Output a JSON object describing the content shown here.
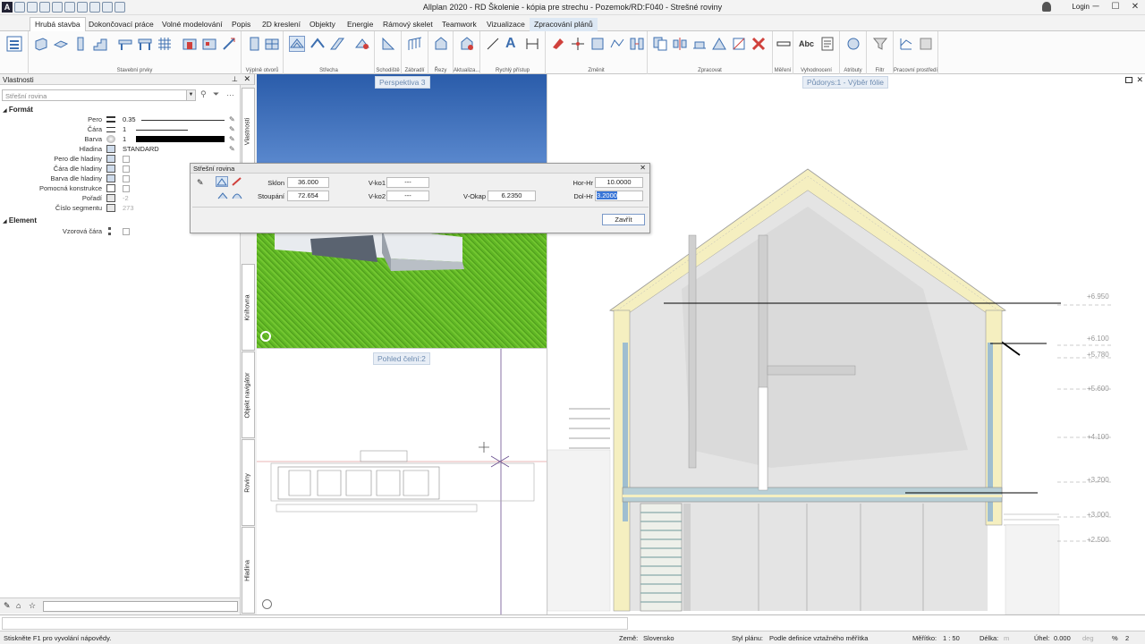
{
  "window": {
    "title": "Allplan 2020 - RD Školenie - kópia pre strechu - Pozemok/RD:F040 - Strešné roviny",
    "login": "Login",
    "app_icon_letter": "A"
  },
  "ribbon": {
    "tabs": [
      "Hrubá stavba",
      "Dokončovací práce",
      "Volné modelování",
      "Popis",
      "2D kreslení",
      "Objekty",
      "Energie",
      "Rámový skelet",
      "Teamwork",
      "Vizualizace",
      "Zpracování plánů"
    ],
    "active_tab": "Hrubá stavba",
    "groups": [
      "Stavební prvky",
      "Výplně otvorů",
      "Střecha",
      "Schodiště",
      "Zábradlí",
      "Řezy",
      "Aktualiza...",
      "Rychlý přístup",
      "Změnit",
      "Zpracovat",
      "Měření",
      "Vyhodnocení",
      "Atributy",
      "Filtr",
      "Pracovní prostředí"
    ]
  },
  "properties": {
    "title": "Vlastnosti",
    "selector_placeholder": "Střešní rovina",
    "section_format": "Formát",
    "section_element": "Element",
    "rows": {
      "pen_label": "Pero",
      "pen_value": "0.35",
      "line_label": "Čára",
      "line_value": "1",
      "color_label": "Barva",
      "color_value": "1",
      "layer_label": "Hladina",
      "layer_value": "STANDARD",
      "pen_by_layer": "Pero dle hladiny",
      "line_by_layer": "Čára dle hladiny",
      "color_by_layer": "Barva dle hladiny",
      "construction_line": "Pomocná konstrukce",
      "order_label": "Pořadí",
      "order_value": "-2",
      "segment_label": "Číslo segmentu",
      "segment_value": "273",
      "pattern_line": "Vzorová čára"
    },
    "side_tabs": [
      "Vlastnosti",
      "Knihovna",
      "Objekt navigátor",
      "Roviny",
      "Hladina"
    ]
  },
  "viewports": {
    "perspective": "Perspektiva 3",
    "front": "Pohled čelní:2",
    "plan": "Půdorys:1 - Výběr fólie"
  },
  "dialog": {
    "title": "Střešní rovina",
    "sklon_label": "Sklon",
    "sklon_value": "36.000",
    "stoupani_label": "Stoupání",
    "stoupani_value": "72.654",
    "vko1_label": "V-ko1",
    "vko1_value": "---",
    "vko2_label": "V-ko2",
    "vko2_value": "---",
    "vokap_label": "V-Okap",
    "vokap_value": "6.2350",
    "horhr_label": "Hor-Hr",
    "horhr_value": "10.0000",
    "dolhr_label": "Dol-Hr",
    "dolhr_value": "3.2000",
    "close_label": "Zavřít"
  },
  "elevations": [
    "+6.950",
    "+6.100",
    "+5.780",
    "+5.600",
    "+4.100",
    "+3.200",
    "+3.000",
    "+2.500"
  ],
  "status": {
    "hint": "Stiskněte F1 pro vyvolání nápovědy.",
    "country_label": "Země:",
    "country_value": "Slovensko",
    "plan_style_label": "Styl plánu:",
    "plan_style_value": "Podle definice vztažného měřítka",
    "scale_label": "Měřítko:",
    "scale_value": "1 : 50",
    "length_label": "Délka:",
    "length_value": "m",
    "angle_label": "Úhel:",
    "angle_value": "0.000",
    "angle_unit": "deg",
    "percent": "%",
    "percent_value": "2"
  },
  "colors": {
    "accent": "#3875d7",
    "sky": "#5d8bd0",
    "grass": "#5fb624",
    "insulation": "#f5efc0"
  }
}
